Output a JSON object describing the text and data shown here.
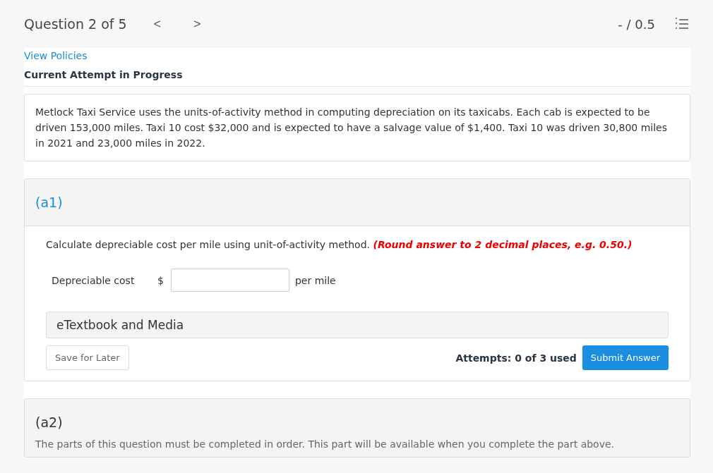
{
  "header": {
    "title": "Question 2 of 5",
    "prev": "<",
    "next": ">",
    "score": "- / 0.5"
  },
  "policies_link": "View Policies",
  "status": "Current Attempt in Progress",
  "question": "Metlock Taxi Service uses the units-of-activity method in computing depreciation on its taxicabs. Each cab is expected to be driven 153,000 miles. Taxi 10 cost $32,000 and is expected to have a salvage value of $1,400. Taxi 10 was driven 30,800 miles in 2021 and 23,000 miles in 2022.",
  "parts": [
    {
      "kind": "active",
      "label": "(a1)",
      "instruction": "Calculate depreciable cost per mile using unit-of-activity method.",
      "note": "(Round answer to 2 decimal places, e.g. 0.50.)",
      "field_label": "Depreciable cost",
      "currency": "$",
      "unit": "per mile",
      "resources": "eTextbook and Media",
      "save": "Save for Later",
      "attempts": "Attempts: 0 of 3 used",
      "submit": "Submit Answer"
    },
    {
      "kind": "locked",
      "label": "(a2)",
      "message": "The parts of this question must be completed in order. This part will be available when you complete the part above."
    }
  ]
}
